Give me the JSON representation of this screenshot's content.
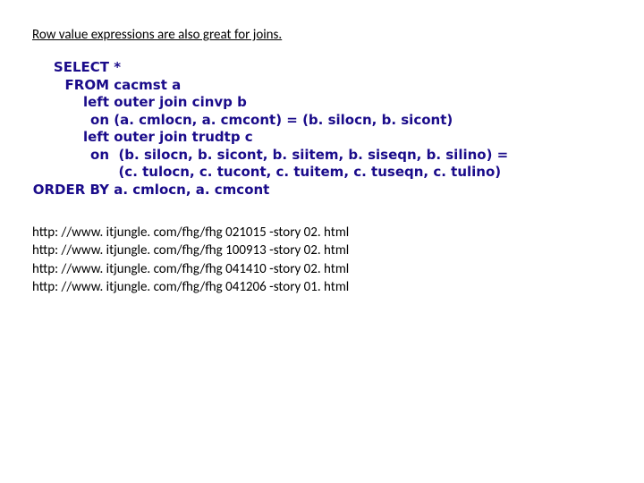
{
  "intro": "Row value expressions are also great for joins.",
  "sql": {
    "k_select": "SELECT",
    "v_select": "*",
    "k_from": "FROM",
    "v_from": "cacmst a",
    "k_left1": "left",
    "v_left1": "outer join cinvp b",
    "k_on1": "on",
    "v_on1": "(a. cmlocn, a. cmcont) = (b. silocn, b. sicont)",
    "k_left2": "left",
    "v_left2": "outer join trudtp c",
    "k_on2": "on",
    "v_on2": " (b. silocn, b. sicont, b. siitem, b. siseqn, b. silino) =",
    "v_on2b": " (c. tulocn, c. tucont, c. tuitem, c. tuseqn, c. tulino)",
    "k_order": "ORDER BY",
    "v_order": "a. cmlocn, a. cmcont"
  },
  "links": [
    "http: //www. itjungle. com/fhg/fhg 021015 -story 02. html",
    "http: //www. itjungle. com/fhg/fhg 100913 -story 02. html",
    "http: //www. itjungle. com/fhg/fhg 041410 -story 02. html",
    "http: //www. itjungle. com/fhg/fhg 041206 -story 01. html"
  ]
}
